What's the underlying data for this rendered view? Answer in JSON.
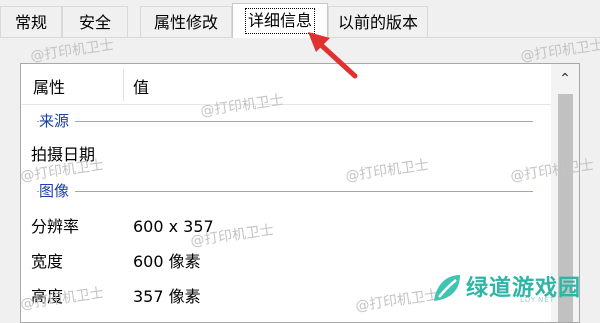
{
  "tabs": [
    "常规",
    "安全",
    "属性修改",
    "详细信息",
    "以前的版本"
  ],
  "active_tab_index": 3,
  "table": {
    "header_property": "属性",
    "header_value": "值",
    "groups": [
      {
        "label": "来源",
        "rows": [
          {
            "name": "拍摄日期",
            "value": ""
          }
        ]
      },
      {
        "label": "图像",
        "rows": [
          {
            "name": "分辨率",
            "value": "600 x 357"
          },
          {
            "name": "宽度",
            "value": "600 像素"
          },
          {
            "name": "高度",
            "value": "357 像素"
          }
        ]
      }
    ]
  },
  "icons": {
    "scroll_up": "chevron-up-icon",
    "annotation": "red-arrow-icon",
    "logo": "ldy-logo-icon"
  },
  "watermark": "@打印机卫士",
  "brand": {
    "name": "绿道游戏园",
    "sub": "LDY.NET"
  },
  "colors": {
    "group_label": "#1b3fa6",
    "group_line": "#94a8d8",
    "arrow": "#e03030",
    "brand": "#2fb5a6"
  }
}
